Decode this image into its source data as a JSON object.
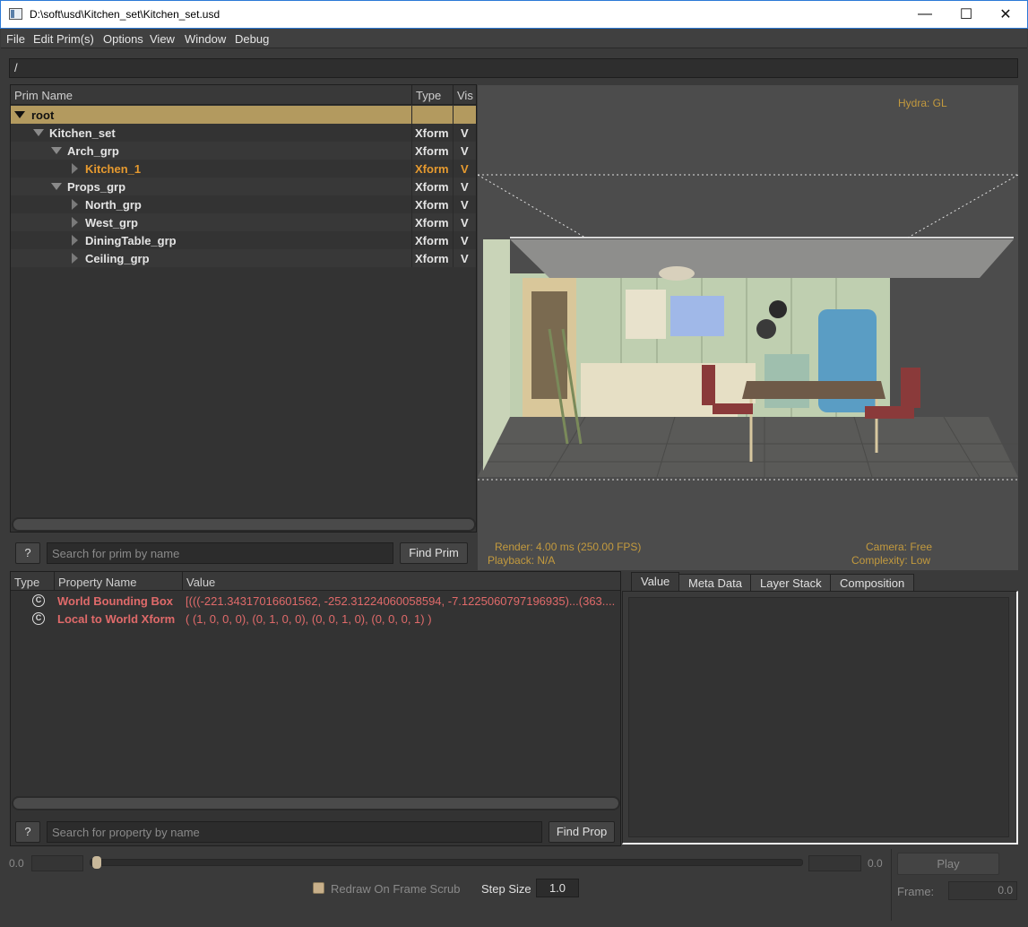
{
  "window": {
    "title": "D:\\soft\\usd\\Kitchen_set\\Kitchen_set.usd",
    "minimize": "—",
    "maximize": "☐",
    "close": "✕"
  },
  "menu": [
    "File",
    "Edit Prim(s)",
    "Options",
    "View",
    "Window",
    "Debug"
  ],
  "path": "/",
  "prim_tree": {
    "headers": {
      "name": "Prim Name",
      "type": "Type",
      "vis": "Vis"
    },
    "rows": [
      {
        "name": "root",
        "type": "",
        "vis": "",
        "expanded": true,
        "depth": 0,
        "selected": true
      },
      {
        "name": "Kitchen_set",
        "type": "Xform",
        "vis": "V",
        "expanded": true,
        "depth": 1
      },
      {
        "name": "Arch_grp",
        "type": "Xform",
        "vis": "V",
        "expanded": true,
        "depth": 2
      },
      {
        "name": "Kitchen_1",
        "type": "Xform",
        "vis": "V",
        "expanded": false,
        "depth": 3,
        "highlight": true
      },
      {
        "name": "Props_grp",
        "type": "Xform",
        "vis": "V",
        "expanded": true,
        "depth": 2
      },
      {
        "name": "North_grp",
        "type": "Xform",
        "vis": "V",
        "expanded": false,
        "depth": 3
      },
      {
        "name": "West_grp",
        "type": "Xform",
        "vis": "V",
        "expanded": false,
        "depth": 3
      },
      {
        "name": "DiningTable_grp",
        "type": "Xform",
        "vis": "V",
        "expanded": false,
        "depth": 3
      },
      {
        "name": "Ceiling_grp",
        "type": "Xform",
        "vis": "V",
        "expanded": false,
        "depth": 3
      }
    ],
    "help_label": "?",
    "search_placeholder": "Search for prim by name",
    "find_label": "Find Prim"
  },
  "viewport": {
    "renderer": "Hydra: GL",
    "render_stats": "Render: 4.00 ms (250.00 FPS)",
    "playback": "Playback: N/A",
    "camera": "Camera: Free",
    "complexity": "Complexity: Low"
  },
  "properties": {
    "headers": {
      "type": "Type",
      "name": "Property Name",
      "value": "Value"
    },
    "rows": [
      {
        "type_icon": "computed-icon",
        "type_glyph": "C",
        "name": "World Bounding Box",
        "value": "[(((-221.34317016601562, -252.31224060058594, -7.1225060797196935)...(363...."
      },
      {
        "type_icon": "computed-icon",
        "type_glyph": "C",
        "name": "Local to World Xform",
        "value": "( (1, 0, 0, 0), (0, 1, 0, 0), (0, 0, 1, 0), (0, 0, 0, 1) )"
      }
    ],
    "help_label": "?",
    "search_placeholder": "Search for property by name",
    "find_label": "Find Prop"
  },
  "tabs": [
    "Value",
    "Meta Data",
    "Layer Stack",
    "Composition"
  ],
  "active_tab": "Value",
  "timeline": {
    "start": "0.0",
    "end": "0.0",
    "redraw_label": "Redraw On Frame Scrub",
    "redraw_checked": true,
    "step_size_label": "Step Size",
    "step_size": "1.0",
    "play_label": "Play",
    "frame_label": "Frame:",
    "frame_value": "0.0"
  },
  "colors": {
    "accent_selection": "#b39a5f",
    "highlight_orange": "#e69a2f",
    "property_red": "#e06a6a",
    "hud_gold": "#c39a3e"
  }
}
